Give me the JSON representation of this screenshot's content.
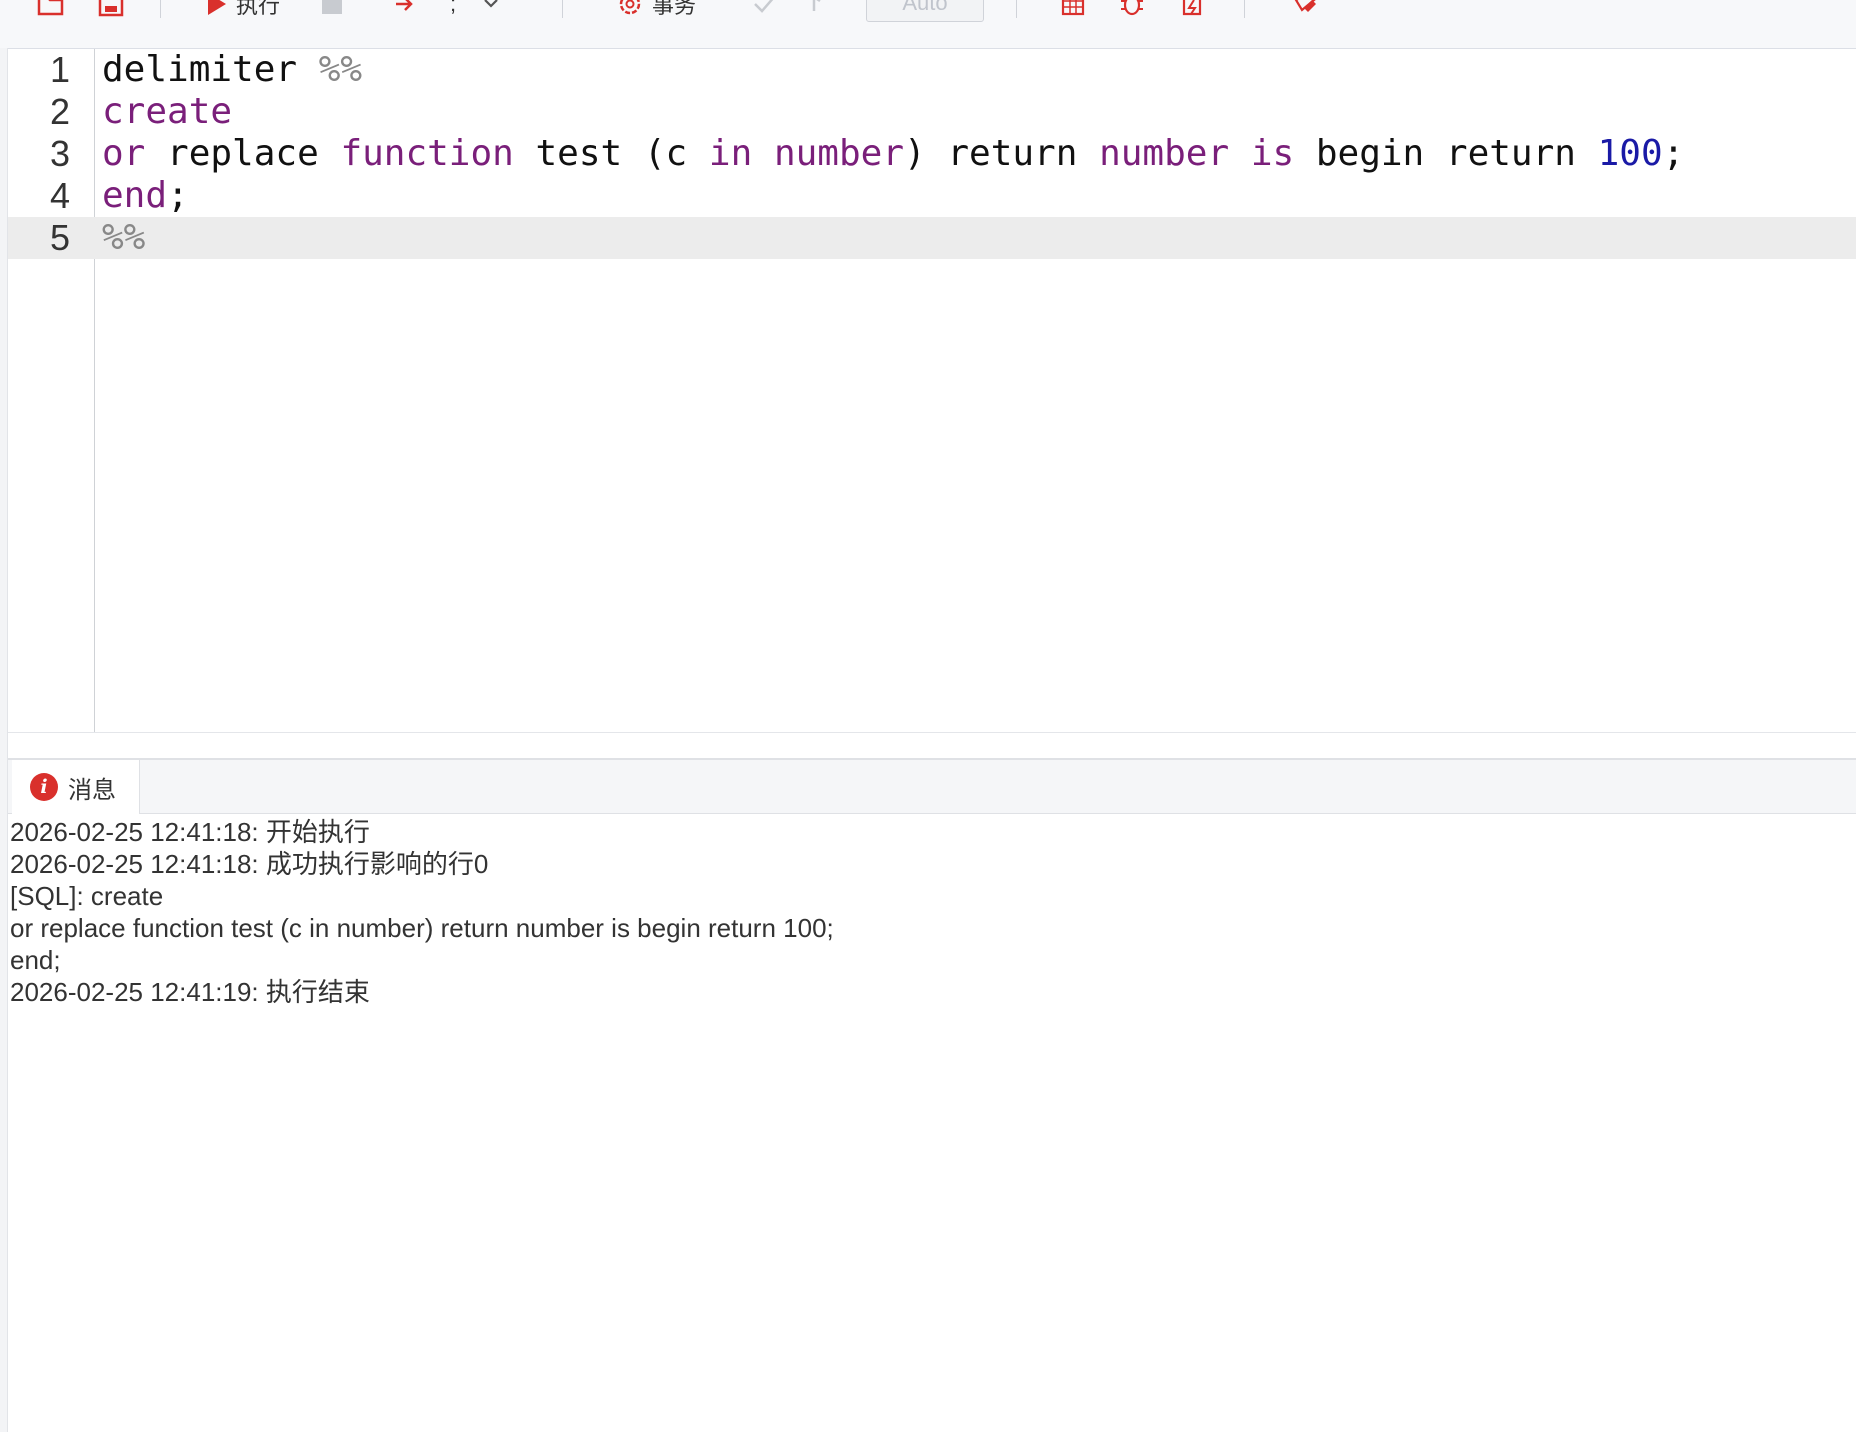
{
  "toolbar": {
    "execute_label": "执行",
    "delimiter_value": ";",
    "transaction_label": "事务",
    "commit_mode_value": "Auto"
  },
  "editor": {
    "lines": [
      {
        "number": "1",
        "text": "delimiter %%"
      },
      {
        "number": "2",
        "text": "create"
      },
      {
        "number": "3",
        "text": "or replace function test (c in number) return number is begin return 100;"
      },
      {
        "number": "4",
        "text": "end;"
      },
      {
        "number": "5",
        "text": "%%"
      }
    ],
    "active_line": 5
  },
  "messages": {
    "tab_label": "消息",
    "lines": [
      "2026-02-25 12:41:18: 开始执行",
      "2026-02-25 12:41:18: 成功执行影响的行0",
      "[SQL]: create",
      "or replace function test (c in number) return number is begin return 100;",
      "end;",
      "2026-02-25 12:41:19: 执行结束"
    ]
  },
  "icons": {
    "open": "folder-open-icon",
    "save": "save-icon",
    "run": "play-icon",
    "stop": "stop-icon",
    "step": "step-arrow-icon",
    "dropdown": "chevron-down-icon",
    "transaction": "gear-icon",
    "commit": "check-icon",
    "rollback": "undo-icon",
    "grid": "table-icon",
    "debug": "bug-icon",
    "export": "export-icon",
    "clear": "eraser-icon",
    "info": "info-icon"
  },
  "colors": {
    "accent": "#d9302c",
    "keyword": "#7a1f7a",
    "number": "#1a1aa6",
    "active_line_bg": "#ececec"
  }
}
